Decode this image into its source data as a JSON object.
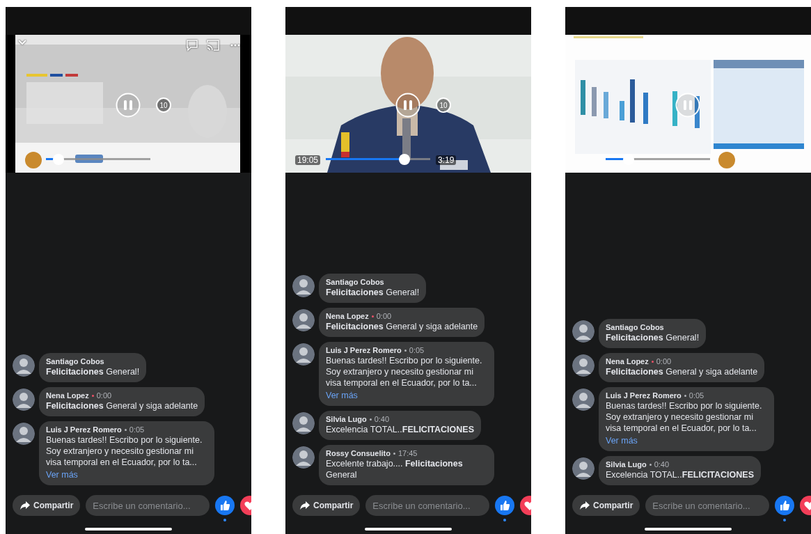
{
  "phones": [
    {
      "video": {
        "top_controls": true,
        "skip_seconds": "10",
        "level": 0.12
      },
      "comments": [
        {
          "author": "Santiago Cobos",
          "text": "**Felicitaciones** General!"
        },
        {
          "author": "Nena Lopez",
          "time": "0:00",
          "live": true,
          "text": "**Felicitaciones** General y siga adelante"
        },
        {
          "author": "Luis J Perez Romero",
          "time": "0:05",
          "live": false,
          "text": "Buenas tardes!! Escribo por lo siguiente. Soy extranjero y necesito gestionar mi visa temporal en el Ecuador, por lo ta...",
          "more": "Ver más"
        }
      ],
      "bar": {
        "share": "Compartir",
        "placeholder": "Escribe un comentario..."
      }
    },
    {
      "video": {
        "top_controls": false,
        "skip_seconds": "10",
        "level": 0.75,
        "elapsed": "19:05",
        "remaining": "3:19"
      },
      "comments": [
        {
          "author": "Santiago Cobos",
          "text": "**Felicitaciones** General!"
        },
        {
          "author": "Nena Lopez",
          "time": "0:00",
          "live": true,
          "text": "**Felicitaciones** General y siga adelante"
        },
        {
          "author": "Luis J Perez Romero",
          "time": "0:05",
          "live": false,
          "text": "Buenas tardes!! Escribo por lo siguiente. Soy extranjero y necesito gestionar mi visa temporal en el Ecuador, por lo ta...",
          "more": "Ver más"
        },
        {
          "author": "Silvia Lugo",
          "time": "0:40",
          "live": false,
          "text": "Excelencia TOTAL..**FELICITACIONES**"
        },
        {
          "author": "Rossy Consuelito",
          "time": "17:45",
          "live": false,
          "text": "Excelente trabajo.... **Felicitaciones** General"
        }
      ],
      "bar": {
        "share": "Compartir",
        "placeholder": "Escribe un comentario..."
      }
    },
    {
      "video": {
        "top_controls": false,
        "level": 0.22
      },
      "comments": [
        {
          "author": "Santiago Cobos",
          "text": "**Felicitaciones** General!"
        },
        {
          "author": "Nena Lopez",
          "time": "0:00",
          "live": true,
          "text": "**Felicitaciones** General y siga adelante"
        },
        {
          "author": "Luis J Perez Romero",
          "time": "0:05",
          "live": false,
          "text": "Buenas tardes!! Escribo por lo siguiente. Soy extranjero y necesito gestionar mi visa temporal en el Ecuador, por lo ta...",
          "more": "Ver más"
        },
        {
          "author": "Silvia Lugo",
          "time": "0:40",
          "live": false,
          "text": "Excelencia TOTAL..**FELICITACIONES**"
        }
      ],
      "bar": {
        "share": "Compartir",
        "placeholder": "Escribe un comentario..."
      }
    }
  ]
}
